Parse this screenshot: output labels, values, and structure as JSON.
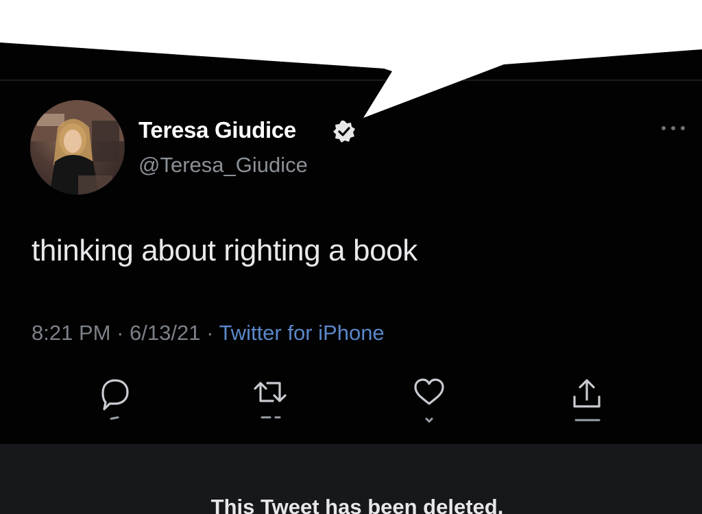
{
  "tweet": {
    "author": {
      "display_name": "Teresa Giudice",
      "handle": "@Teresa_Giudice",
      "verified": true
    },
    "text": "thinking about righting a book",
    "time": "8:21 PM",
    "date": "6/13/21",
    "source": "Twitter for iPhone",
    "separator": " · "
  },
  "actions": [
    {
      "name": "reply",
      "icon": "reply-icon"
    },
    {
      "name": "retweet",
      "icon": "retweet-icon"
    },
    {
      "name": "like",
      "icon": "heart-icon"
    },
    {
      "name": "share",
      "icon": "share-icon"
    }
  ],
  "deleted_notice": "This Tweet has been deleted.",
  "colors": {
    "background": "#020203",
    "text": "#e8e9eb",
    "secondary": "#7c8188",
    "link": "#5b87c9",
    "notice_bg": "#17181c"
  }
}
